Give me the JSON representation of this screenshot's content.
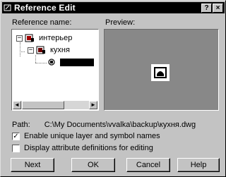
{
  "window": {
    "title": "Reference Edit",
    "help_button": "?",
    "close_button": "×"
  },
  "labels": {
    "reference_name": "Reference name:",
    "preview": "Preview:"
  },
  "tree": {
    "nodes": [
      {
        "label": "интерьер",
        "expander": "−",
        "selected": false
      },
      {
        "label": "кухня",
        "expander": "−",
        "selected": false
      },
      {
        "label": "",
        "expander": "",
        "selected": true
      }
    ]
  },
  "path": {
    "label": "Path:",
    "value": "C:\\My Documents\\vvalka\\backup\\кухня.dwg"
  },
  "options": {
    "enable_unique": {
      "label": "Enable unique layer and symbol names",
      "checked": true,
      "mark": "✓"
    },
    "display_attribute": {
      "label": "Display attribute definitions for editing",
      "checked": false,
      "mark": ""
    }
  },
  "buttons": {
    "next": "Next",
    "ok": "OK",
    "cancel": "Cancel",
    "help": "Help"
  },
  "colors": {
    "dialog_bg": "#c3c3c3",
    "titlebar_bg": "#000000",
    "preview_bg": "#888888"
  }
}
